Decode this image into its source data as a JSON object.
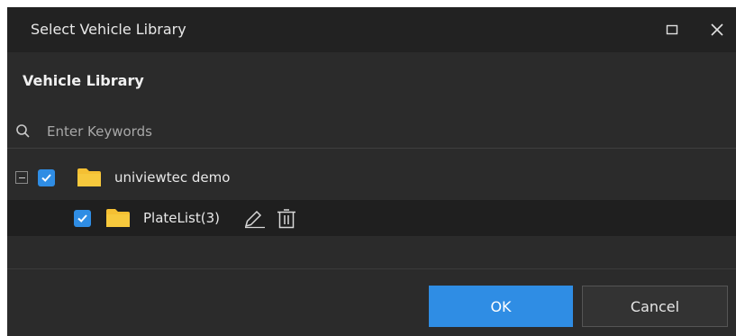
{
  "dialog": {
    "title": "Select Vehicle Library",
    "maximize_icon": "maximize-icon",
    "close_icon": "close-icon"
  },
  "section": {
    "label": "Vehicle Library"
  },
  "search": {
    "placeholder": "Enter Keywords",
    "value": "",
    "icon": "search-icon"
  },
  "tree": {
    "root": {
      "label": "univiewtec demo",
      "checked": true,
      "expanded": true,
      "icon": "folder-icon"
    },
    "children": [
      {
        "label": "PlateList(3)",
        "checked": true,
        "icon": "folder-icon",
        "actions": [
          "edit-icon",
          "delete-icon"
        ]
      }
    ]
  },
  "footer": {
    "ok_label": "OK",
    "cancel_label": "Cancel"
  },
  "colors": {
    "accent": "#2f8de4",
    "folder": "#f5c033",
    "background": "#2b2b2b",
    "titlebar": "#222222",
    "selected_row": "#1f1f1f"
  }
}
